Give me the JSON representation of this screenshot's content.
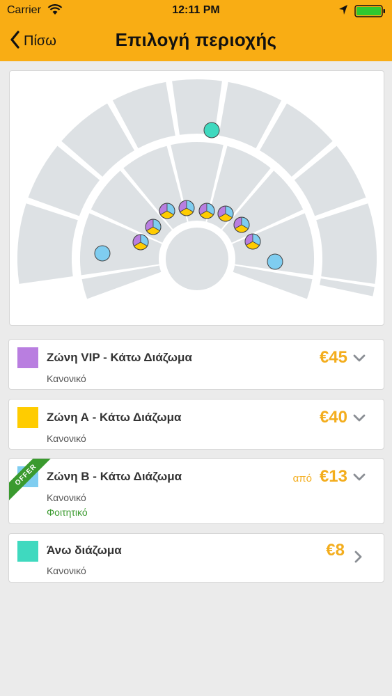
{
  "status_bar": {
    "carrier": "Carrier",
    "time": "12:11 PM"
  },
  "nav": {
    "back_label": "Πίσω",
    "title": "Επιλογή περιοχής"
  },
  "colors": {
    "header": "#f9ad14",
    "price": "#f3ad1d",
    "vip": "#b97ee0",
    "zone_a": "#ffcc00",
    "zone_b": "#7fcdf0",
    "upper": "#3fd9bf",
    "student": "#3a9a2e",
    "sector": "#dde1e4"
  },
  "zones": [
    {
      "name": "Ζώνη VIP - Κάτω Διάζωμα",
      "type": "Κανονικό",
      "price": "€45",
      "icon": "chevron-down-icon"
    },
    {
      "name": "Ζώνη Α - Κάτω Διάζωμα",
      "type": "Κανονικό",
      "price": "€40",
      "icon": "chevron-down-icon"
    },
    {
      "name": "Ζώνη Β - Κάτω Διάζωμα",
      "type": "Κανονικό",
      "type2": "Φοιτητικό",
      "from": "από",
      "price": "€13",
      "offer": "OFFER",
      "icon": "chevron-down-icon"
    },
    {
      "name": "Άνω διάζωμα",
      "type": "Κανονικό",
      "price": "€8",
      "icon": "chevron-right-icon"
    }
  ]
}
